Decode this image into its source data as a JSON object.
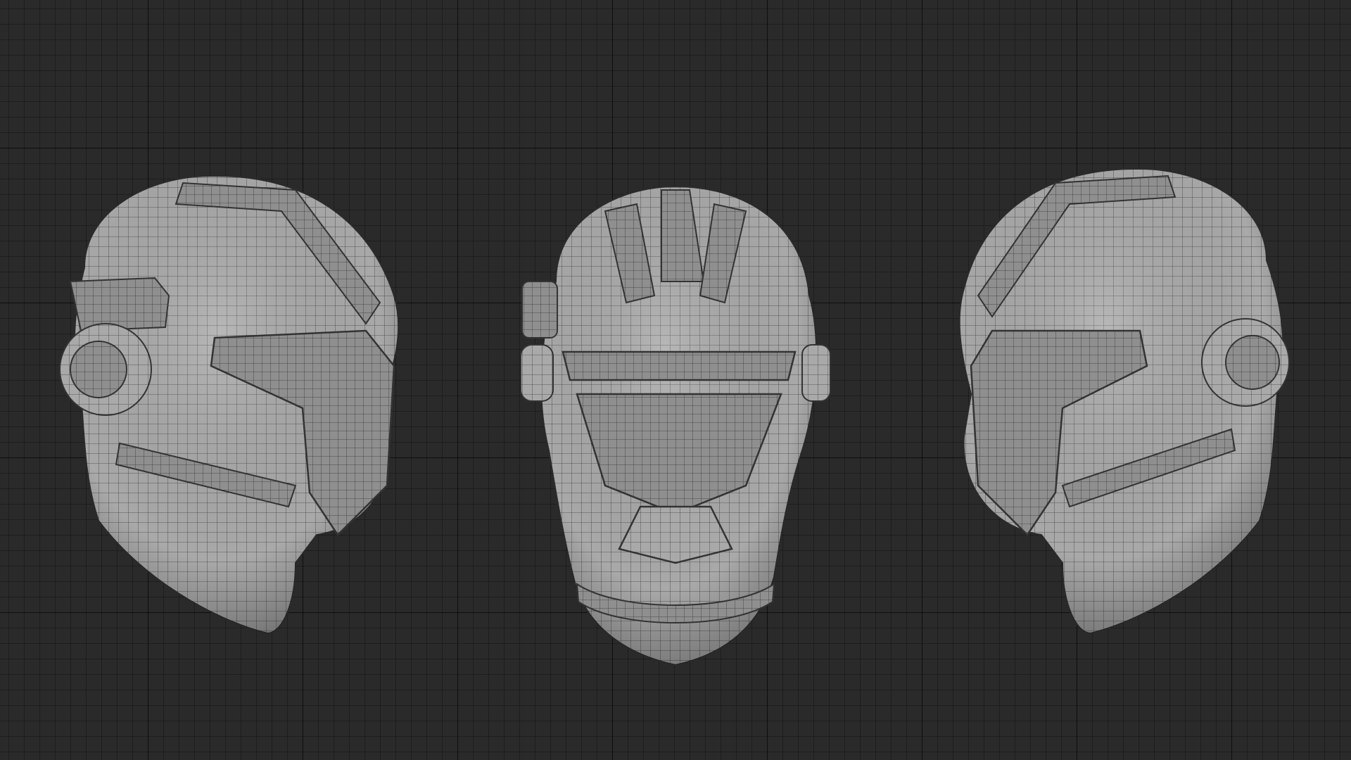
{
  "app": {
    "view": "3D viewport",
    "background_color": "#2b2b2b",
    "grid_color": "#1f1f1f",
    "mesh_color": "#a7a7a7",
    "wire_color": "#3a3a3a"
  },
  "objects": [
    {
      "name": "helmet-left-side-view",
      "icon": "mesh-object"
    },
    {
      "name": "helmet-front-view",
      "icon": "mesh-object"
    },
    {
      "name": "helmet-right-side-view",
      "icon": "mesh-object"
    }
  ]
}
